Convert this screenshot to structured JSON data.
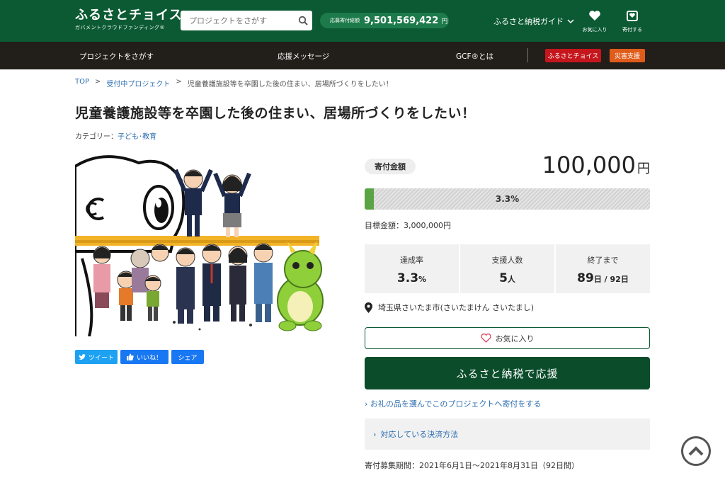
{
  "header": {
    "logo_main": "ふるさとチョイス",
    "logo_sub": "ガバメントクラウドファンディング®",
    "search_placeholder": "プロジェクトをさがす",
    "total_label": "応募寄付総額",
    "total_value": "9,501,569,422",
    "total_unit": "円",
    "guide_label": "ふるさと納税ガイド",
    "favorites_label": "お気に入り",
    "donate_label": "寄付する"
  },
  "nav": {
    "find": "プロジェクトをさがす",
    "messages": "応援メッセージ",
    "about": "GCF®とは",
    "choice_btn": "ふるさとチョイス",
    "disaster_btn": "災害支援",
    "choice_color": "#c5161d",
    "disaster_color": "#e05c1a"
  },
  "breadcrumb": {
    "top": "TOP",
    "sep": ">",
    "accepting": "受付中プロジェクト",
    "current": "児童養護施設等を卒園した後の住まい、居場所づくりをしたい！"
  },
  "project": {
    "title": "児童養護施設等を卒園した後の住まい、居場所づくりをしたい！",
    "category_label": "カテゴリー：",
    "category_value": "子ども･教育"
  },
  "share": {
    "tweet": "ツイート",
    "like": "いいね！",
    "share": "シェア"
  },
  "funding": {
    "amount_label": "寄付金額",
    "amount": "100,000",
    "amount_unit": "円",
    "progress_percent": 3.3,
    "progress_text": "3.3%",
    "goal_text": "目標金額：3,000,000円"
  },
  "stats": {
    "rate_label": "達成率",
    "rate_value": "3.3",
    "rate_unit": "%",
    "supporters_label": "支援人数",
    "supporters_value": "5",
    "supporters_unit": "人",
    "remaining_label": "終了まで",
    "remaining_value": "89",
    "remaining_unit": "日 / 92日"
  },
  "location": "埼玉県さいたま市(さいたまけん さいたまし)",
  "actions": {
    "favorite": "お気に入り",
    "donate_main": "ふるさと納税で応援",
    "gift_link": "お礼の品を選んでこのプロジェクトへ寄付をする",
    "payment_methods": "対応している決済方法"
  },
  "period": "寄付募集期間：2021年6月1日〜2021年8月31日（92日間）",
  "colors": {
    "brand_green": "#0b5a33",
    "progress_green": "#5aa445",
    "twitter": "#1da1f2",
    "facebook": "#1877f2"
  }
}
